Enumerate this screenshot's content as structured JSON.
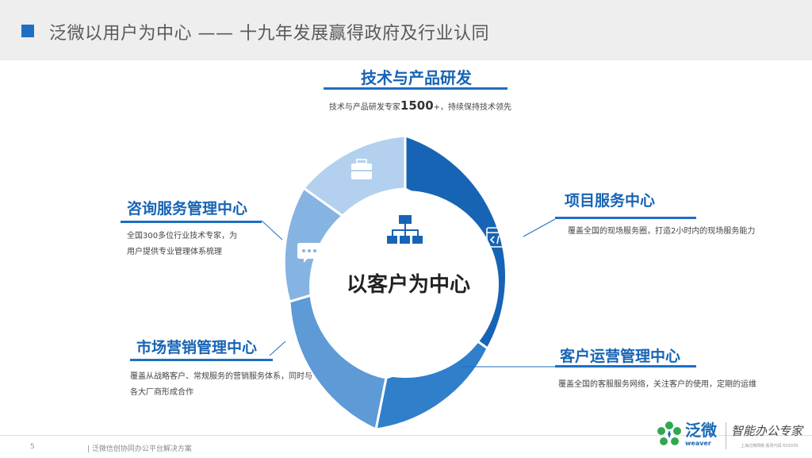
{
  "header": {
    "title": "泛微以用户为中心 —— 十九年发展赢得政府及行业认同"
  },
  "top": {
    "title": "技术与产品研发",
    "desc_pre": "技术与产品研发专家",
    "desc_number": "1500",
    "desc_post": "+，持续保持技术领先"
  },
  "sections": {
    "consult": {
      "title": "咨询服务管理中心",
      "line1": "全国300多位行业技术专家，为",
      "line2": "用户提供专业管理体系梳理"
    },
    "marketing": {
      "title": "市场营销管理中心",
      "line1": "覆盖从战略客户、常规服务的营销服务体系，同时与",
      "line2": "各大厂商形成合作"
    },
    "project": {
      "title": "项目服务中心",
      "line1": "覆盖全国的现场服务圈，打造2小时内的现场服务能力"
    },
    "ops": {
      "title": "客户运营管理中心",
      "line1": "覆盖全国的客服服务网络，关注客户的使用，定期的运维"
    }
  },
  "center": {
    "text": "以客户为中心"
  },
  "footer": {
    "page": "5",
    "text": "| 泛微信创协同办公平台解决方案",
    "brand": "泛微",
    "brand_en": "weaver",
    "slogan": "智能办公专家",
    "small": "上海泛微网络 股票代码 603039"
  },
  "colors": {
    "accent": "#1e6fc2",
    "seg_project": "#1764b5",
    "seg_ops": "#2f7fcb",
    "seg_market": "#5d9ad6",
    "seg_consult": "#86b4e2",
    "seg_top": "#b3d1ee"
  },
  "icons": {
    "center": "org-chart-icon",
    "project": "code-window-icon",
    "ops": "inbox-tray-icon",
    "market": "cube-icon",
    "consult": "chat-bubble-icon",
    "top": "briefcase-icon"
  }
}
